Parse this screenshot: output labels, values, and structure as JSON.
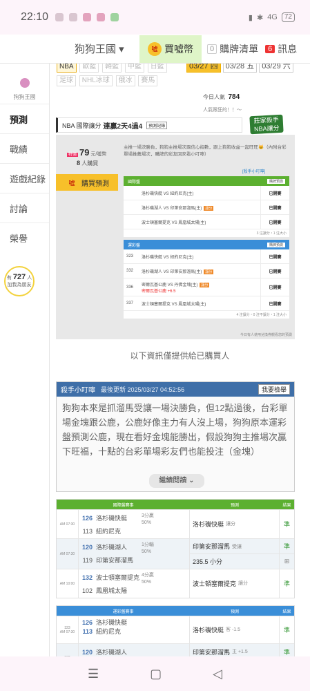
{
  "status": {
    "time": "22:10",
    "battery": "72",
    "signal": "4G"
  },
  "topnav": {
    "site": "狗狗王國 ▾",
    "coin_label": "買噓幣",
    "coin_icon": "噓",
    "list_count": "0",
    "list_label": "購牌清單",
    "msg_count": "6",
    "msg_label": "訊息"
  },
  "sidebar": {
    "logo_text": "狗狗王國",
    "items": [
      "預測",
      "戰績",
      "遊戲紀錄",
      "討論",
      "榮譽"
    ],
    "fans_prefix": "有",
    "fans_count": "727",
    "fans_suffix": "人",
    "fans_line2": "加我為朋友"
  },
  "tags": [
    "NBA",
    "歐籃",
    "韓籃",
    "中籃",
    "日籃",
    "足球",
    "NHL冰球",
    "俄冰",
    "賽馬"
  ],
  "dates": [
    "03/27 四",
    "03/28 五",
    "03/29 六"
  ],
  "popularity": {
    "label": "今日人氣",
    "value": "784",
    "line2": "人氣跟狂的！！～"
  },
  "stamp": {
    "line1": "莊家殺手",
    "line2": "NBA讓分"
  },
  "pick_header": {
    "league": "NBA 國際讓分",
    "streak": "連贏2天4過4",
    "record": "預測記錄"
  },
  "pack": {
    "sale": "特價",
    "price": "79",
    "unit": "元/噓幣",
    "buyers": "8",
    "buyers_unit": "人購買",
    "buy_button": "購買預測",
    "buy_icon": "噓",
    "intro": "主推一場決勝負，狗狗主推場次兩信心指數，跟上狗狗收益一起旺旺🐱（內附台彩單場推薦場次，購牌的彩友回來看小叮嚀）",
    "mini_link": "[殺手小叮嚀]"
  },
  "intl_table": {
    "header": "國際盤",
    "chip": "購牌預測",
    "rows": [
      {
        "match": "洛杉磯快艇 VS 紐約尼克(主)",
        "status": "已開賽"
      },
      {
        "match": "洛杉磯湖人 VS 印第安那溜馬(主)",
        "status": "已開賽",
        "tag": "讓分"
      },
      {
        "match": "波士頓塞爾提克 VS 鳳凰城太陽(主)",
        "status": "已開賽"
      }
    ],
    "footer": "3 注讓分・1 注大小"
  },
  "tw_table": {
    "header": "運彩盤",
    "chip": "購牌預測",
    "rows": [
      {
        "no": "323",
        "match": "洛杉磯快艇 VS 紐約尼克(主)",
        "status": "已開賽"
      },
      {
        "no": "332",
        "match": "洛杉磯湖人 VS 印第安那溜馬(主)",
        "status": "已開賽",
        "tag": "讓分"
      },
      {
        "no": "336",
        "match": "密爾瓦基公鹿 VS 丹佛金塊(主)",
        "extra": "密爾瓦基公鹿 +6.5",
        "status": "已開賽",
        "tag": "讓分"
      },
      {
        "no": "337",
        "match": "波士頓塞爾提克 VS 鳳凰城太陽(主)",
        "status": "已開賽"
      }
    ],
    "footer": "4 注讓分・0 注不讓分・1 注大小"
  },
  "note": "今日有人使用兌換券觀看您的預測",
  "info_text": "以下資訊僅提供給已購買人",
  "tip": {
    "title": "殺手小叮嚀",
    "updated": "最後更新 2025/03/27 04:52:56",
    "check": "我要檢舉",
    "body": "狗狗本來是抓溜馬受讓一場決勝負，但12點過後，台彩單場金塊跟公鹿，公鹿好像主力有人沒上場，狗狗原本運彩盤預測公鹿，現在看好金塊能勝出，假設狗狗主推場次贏下旺福，十點的台彩單場彩友們也能投注（金塊）",
    "more": "繼續閱讀 ⌄"
  },
  "pred_intl": {
    "headers": [
      "國際盤賽事",
      "預測",
      "結果"
    ],
    "rows": [
      {
        "time": "AM 07:30",
        "home_no": "126",
        "home": "洛杉磯快艇",
        "away_no": "113",
        "away": "紐約尼克",
        "spread": "3分贏",
        "pct": "50%",
        "pick": "洛杉磯快艇",
        "pick_sub": "讓分",
        "result": "準"
      },
      {
        "time": "AM 07:30",
        "home_no": "120",
        "home": "洛杉磯湖人",
        "away_no": "119",
        "away": "印第安那溜馬",
        "spread": "1分輸",
        "pct": "50%",
        "pick": "印第安那溜馬",
        "pick_sub": "受讓",
        "result": "準",
        "pick2": "235.5 小分",
        "result2": "⊞"
      },
      {
        "time": "AM 10:00",
        "home_no": "132",
        "home": "波士頓塞爾提克",
        "away_no": "102",
        "away": "鳳凰城太陽",
        "spread": "4分贏",
        "pct": "50%",
        "pick": "波士頓塞爾提克",
        "pick_sub": "讓分",
        "result": "準"
      }
    ]
  },
  "pred_tw": {
    "headers": [
      "運彩盤賽事",
      "預測",
      "結果"
    ],
    "rows": [
      {
        "no": "323",
        "time": "AM 07:30",
        "home_no": "126",
        "home": "洛杉磯快艇",
        "away_no": "113",
        "away": "紐約尼克",
        "pick": "洛杉磯快艇",
        "pick_sub": "客 -1.5",
        "result": "準"
      },
      {
        "no": "332",
        "time": "",
        "home_no": "120",
        "home": "洛杉磯湖人",
        "away_no": "",
        "away": "",
        "pick": "印第安那溜馬",
        "pick_sub": "主 +1.5",
        "result": "準"
      }
    ]
  }
}
